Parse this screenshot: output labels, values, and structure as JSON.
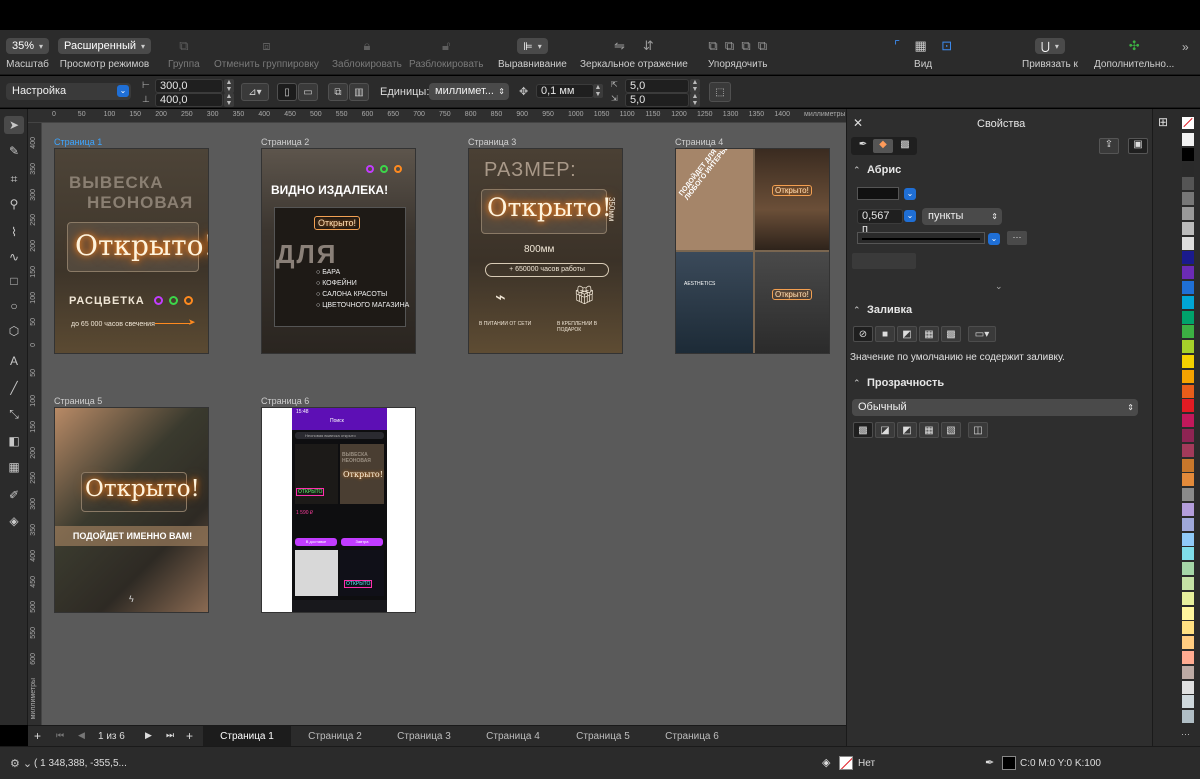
{
  "toolbar": {
    "zoom": "35%",
    "zoom_label": "Масштаб",
    "view_mode": "Расширенный",
    "view_mode_label": "Просмотр режимов",
    "group_label": "Группа",
    "ungroup_label": "Отменить группировку",
    "lock_label": "Заблокировать",
    "unlock_label": "Разблокировать",
    "align_label": "Выравнивание",
    "mirror_label": "Зеркальное отражение",
    "arrange_label": "Упорядочить",
    "view_label": "Вид",
    "snap_label": "Привязать к",
    "more_label": "Дополнительно..."
  },
  "propbar": {
    "preset": "Настройка",
    "width": "300,0",
    "height": "400,0",
    "units_label": "Единицы:",
    "units": "миллимет...",
    "nudge": "0,1 мм",
    "dup_x": "5,0",
    "dup_y": "5,0"
  },
  "ruler": {
    "h_ticks": [
      "0",
      "50",
      "100",
      "150",
      "200",
      "250",
      "300",
      "350",
      "400",
      "450",
      "500",
      "550",
      "600",
      "650",
      "700",
      "750",
      "800",
      "850",
      "900",
      "950",
      "1000",
      "1050",
      "1100",
      "1150",
      "1200",
      "1250",
      "1300",
      "1350",
      "1400"
    ],
    "units": "миллиметры",
    "v_ticks": [
      "400",
      "350",
      "300",
      "250",
      "200",
      "150",
      "100",
      "50",
      "0",
      "50",
      "100",
      "150",
      "200",
      "250",
      "300",
      "350",
      "400",
      "450",
      "500",
      "550",
      "600"
    ]
  },
  "pages": [
    {
      "label": "Страница 1",
      "title1": "ВЫВЕСКА",
      "title2": "НЕОНОВАЯ",
      "sign": "Открыто!",
      "caption": "РАСЦВЕТКА",
      "footer": "до 65 000 часов свечения"
    },
    {
      "label": "Страница 2",
      "headline": "ВИДНО ИЗДАЛЕКА!",
      "sign": "Открыто!",
      "big": "ДЛЯ",
      "items": [
        "БАРА",
        "КОФЕЙНИ",
        "САЛОНА КРАСОТЫ",
        "ЦВЕТОЧНОГО МАГАЗИНА"
      ]
    },
    {
      "label": "Страница 3",
      "title": "РАЗМЕР:",
      "sign": "Открыто!",
      "height_dim": "350мм",
      "width_dim": "800мм",
      "hours": "+ 650000 часов работы",
      "left_caption": "В ПИТАНИИ ОТ СЕТИ",
      "right_caption": "В КРЕПЛЕНИИ В ПОДАРОК"
    },
    {
      "label": "Страница 4",
      "diag": "ПОДОЙДЕТ ДЛЯ ЛЮБОГО ИНТЕРЬЕРА!",
      "sign1": "Открыто!",
      "shop": "AESTHETICS",
      "sign2": "Открыто!"
    },
    {
      "label": "Страница 5",
      "sign": "Открыто!",
      "banner": "ПОДОЙДЕТ ИМЕННО ВАМ!"
    },
    {
      "label": "Страница 6",
      "time": "15:48",
      "screen_title": "Поиск",
      "search": "Неоновая вывеска открыто",
      "card1": "ВЫВЕСКА НЕОНОВАЯ",
      "card_sign": "Открыто!",
      "card_sign2": "ОТКРЫТО",
      "price": "1 590 ₽",
      "btn1": "В доставке",
      "btn2": "Завтра"
    }
  ],
  "pagebar": {
    "current": "1",
    "of": "из",
    "total": "6",
    "tabs": [
      "Страница 1",
      "Страница 2",
      "Страница 3",
      "Страница 4",
      "Страница 5",
      "Страница 6"
    ]
  },
  "status": {
    "coords": "( 1 348,388, -355,5...",
    "fill_none": "Нет",
    "outline_color": "C:0 M:0 Y:0 K:100"
  },
  "props": {
    "title": "Свойства",
    "outline_title": "Абрис",
    "outline_width": "0,567 п",
    "outline_units": "пункты",
    "fill_title": "Заливка",
    "fill_note": "Значение по умолчанию не содержит заливку.",
    "transparency_title": "Прозрачность",
    "transparency_mode": "Обычный"
  },
  "palette": [
    "#f2f2f2",
    "#000000",
    "#2a2a2a",
    "#555555",
    "#777777",
    "#999999",
    "#bbbbbb",
    "#dddddd",
    "#1a1a8c",
    "#6b2bb5",
    "#1f6fd6",
    "#00a6d6",
    "#00a36b",
    "#3cb043",
    "#a6d12a",
    "#f5d100",
    "#f5a300",
    "#e85d1a",
    "#e21b23",
    "#c2185b",
    "#8e2453",
    "#a23a5a",
    "#c7772b",
    "#e38a3a",
    "#8a8a8a",
    "#b39ddb",
    "#9fa8da",
    "#90caf9",
    "#80deea",
    "#a5d6a7",
    "#c5e1a5",
    "#e6ee9c",
    "#fff59d",
    "#ffe082",
    "#ffcc80",
    "#ffab91",
    "#bcaaa4",
    "#e0e0e0",
    "#cfd8dc",
    "#b0bec5"
  ]
}
